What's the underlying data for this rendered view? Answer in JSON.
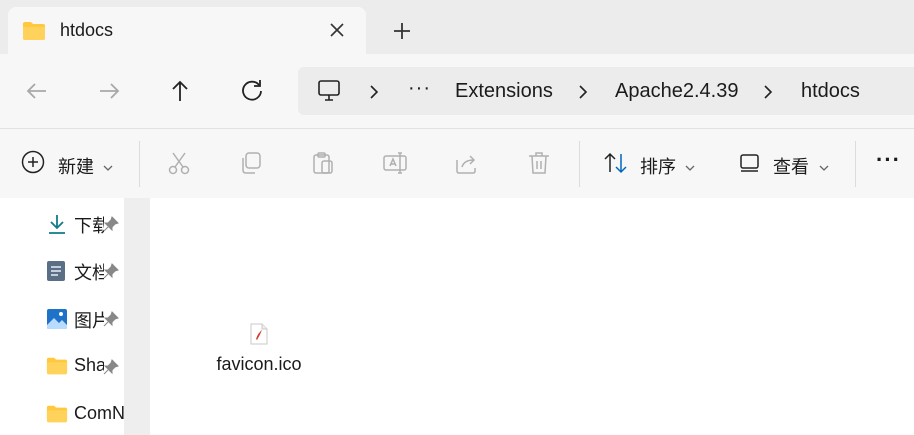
{
  "tab": {
    "title": "htdocs",
    "folder_icon": "folder-icon",
    "close_icon": "close-icon"
  },
  "new_tab_icon": "plus-icon",
  "nav": {
    "back_icon": "arrow-left-icon",
    "forward_icon": "arrow-right-icon",
    "up_icon": "arrow-up-icon",
    "refresh_icon": "refresh-icon"
  },
  "address": {
    "root_icon": "computer-icon",
    "overflow": "···",
    "crumbs": [
      "Extensions",
      "Apache2.4.39",
      "htdocs"
    ]
  },
  "toolbar": {
    "new_label": "新建",
    "sort_label": "排序",
    "view_label": "查看",
    "more_label": "···",
    "actions": [
      "cut-icon",
      "copy-icon",
      "paste-icon",
      "rename-icon",
      "share-icon",
      "delete-icon"
    ]
  },
  "sidebar": {
    "items": [
      {
        "label": "下载",
        "icon": "download-icon"
      },
      {
        "label": "文档",
        "icon": "document-icon"
      },
      {
        "label": "图片",
        "icon": "pictures-icon"
      },
      {
        "label": "Share",
        "icon": "folder-icon"
      },
      {
        "label": "ComN",
        "icon": "folder-icon"
      }
    ]
  },
  "files": [
    {
      "name": "favicon.ico",
      "icon": "ico-file-icon"
    }
  ],
  "colors": {
    "accent": "#0067c0",
    "folder": "#ffc83d",
    "titlebar": "#ececec",
    "toolbar": "#f7f7f7"
  }
}
